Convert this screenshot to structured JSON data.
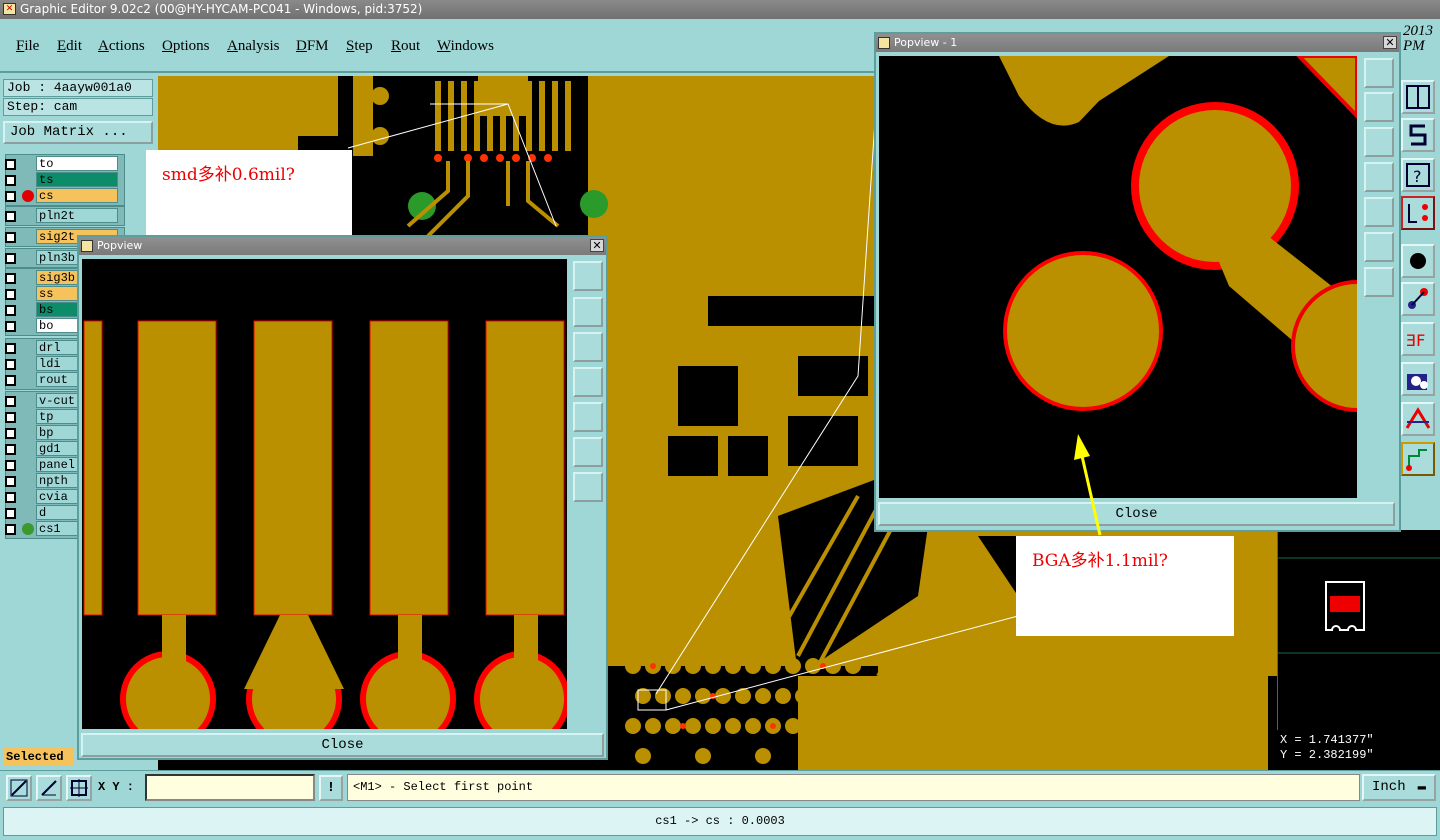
{
  "window": {
    "title": "Graphic Editor 9.02c2 (00@HY-HYCAM-PC041 - Windows, pid:3752)"
  },
  "menu": [
    "File",
    "Edit",
    "Actions",
    "Options",
    "Analysis",
    "DFM",
    "Step",
    "Rout",
    "Windows"
  ],
  "clock": {
    "date_fragment": "2013",
    "time_fragment": "PM"
  },
  "job": {
    "job": "Job : 4aayw001a0",
    "step": "Step: cam",
    "matrix_button": "Job Matrix ..."
  },
  "layers": [
    {
      "name": "to",
      "color": "#ffffff",
      "group": 1
    },
    {
      "name": "ts",
      "color": "#0d8c6a",
      "group": 1
    },
    {
      "name": "cs",
      "color": "#f5c25b",
      "group": 1,
      "active": true,
      "dot": "#e00000"
    },
    {
      "name": "pln2t",
      "color": "#9fd7d6",
      "group": 2
    },
    {
      "name": "sig2t",
      "color": "#f5c25b",
      "group": 3
    },
    {
      "name": "pln3b",
      "color": "#9fd7d6",
      "group": 4
    },
    {
      "name": "sig3b",
      "color": "#f5c25b",
      "group": 5
    },
    {
      "name": "ss",
      "color": "#f5c25b",
      "group": 5
    },
    {
      "name": "bs",
      "color": "#0d8c6a",
      "group": 5
    },
    {
      "name": "bo",
      "color": "#ffffff",
      "group": 5
    },
    {
      "name": "drl",
      "color": "#9fd7d6",
      "group": 6
    },
    {
      "name": "ldi",
      "color": "#9fd7d6",
      "group": 6
    },
    {
      "name": "rout",
      "color": "#9fd7d6",
      "group": 6
    },
    {
      "name": "v-cut",
      "color": "#9fd7d6",
      "group": 7
    },
    {
      "name": "tp",
      "color": "#9fd7d6",
      "group": 7
    },
    {
      "name": "bp",
      "color": "#9fd7d6",
      "group": 7
    },
    {
      "name": "gd1",
      "color": "#9fd7d6",
      "group": 7
    },
    {
      "name": "panel",
      "color": "#9fd7d6",
      "group": 7
    },
    {
      "name": "npth",
      "color": "#9fd7d6",
      "group": 7
    },
    {
      "name": "cvia",
      "color": "#9fd7d6",
      "group": 7
    },
    {
      "name": "d",
      "color": "#9fd7d6",
      "group": 7
    },
    {
      "name": "cs1",
      "color": "#9fd7d6",
      "group": 7,
      "dot": "#3a9a2a"
    }
  ],
  "selected_label": "Selected :",
  "popview1": {
    "title": "Popview",
    "close": "Close"
  },
  "popview2": {
    "title": "Popview - 1",
    "close": "Close"
  },
  "notes": {
    "smd": "smd多补0.6mil?",
    "bga": "BGA多补1.1mil?"
  },
  "coords": {
    "x": "X = 1.741377\"",
    "y": "Y = 2.382199\""
  },
  "command": {
    "xy_label": "X Y :",
    "xy_value": "",
    "bang": "!",
    "prompt": "<M1> - Select first point",
    "units": "Inch"
  },
  "status": "cs1 -> cs : 0.0003",
  "colors": {
    "copper": "#bb9000",
    "clearance": "#ff0000",
    "background": "#000000",
    "ui": "#9fd7d6"
  }
}
